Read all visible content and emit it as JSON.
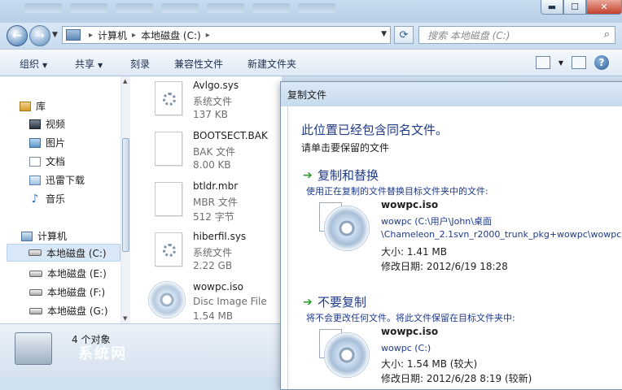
{
  "explorer": {
    "address_segments": [
      "计算机",
      "本地磁盘 (C:)"
    ],
    "search_placeholder": "搜索 本地磁盘 (C:)",
    "toolbar": {
      "organize": "组织",
      "share": "共享",
      "burn": "刻录",
      "compat_files": "兼容性文件",
      "new_folder": "新建文件夹"
    },
    "nav": {
      "library": "库",
      "videos": "视频",
      "pictures": "图片",
      "documents": "文档",
      "thunder": "迅雷下载",
      "music": "音乐",
      "computer": "计算机",
      "drive_c": "本地磁盘 (C:)",
      "drive_e": "本地磁盘 (E:)",
      "drive_f": "本地磁盘 (F:)",
      "drive_g": "本地磁盘 (G:)"
    },
    "files": [
      {
        "name": "Avlgo.sys",
        "type": "系统文件",
        "size": "137 KB",
        "icon": "gear-file-icon"
      },
      {
        "name": "BOOTSECT.BAK",
        "type": "BAK 文件",
        "size": "8.00 KB",
        "icon": "blank-file-icon"
      },
      {
        "name": "btldr.mbr",
        "type": "MBR 文件",
        "size": "512 字节",
        "icon": "blank-file-icon"
      },
      {
        "name": "hiberfil.sys",
        "type": "系统文件",
        "size": "2.22 GB",
        "icon": "gear-file-icon"
      },
      {
        "name": "wowpc.iso",
        "type": "Disc Image File",
        "size": "1.54 MB",
        "icon": "disc-icon"
      }
    ],
    "status_count": "4 个对象",
    "watermark": "系统网"
  },
  "dialog": {
    "title": "复制文件",
    "heading": "此位置已经包含同名文件。",
    "subheading": "请单击要保留的文件",
    "replace": {
      "title": "复制和替换",
      "desc": "使用正在复制的文件替换目标文件夹中的文件:",
      "file_name": "wowpc.iso",
      "path_line1": "wowpc (C:\\用户\\John\\桌面",
      "path_line2": "\\Chameleon_2.1svn_r2000_trunk_pkg+wowpc\\wowpc",
      "size": "大小: 1.41 MB",
      "date": "修改日期: 2012/6/19 18:28"
    },
    "skip": {
      "title": "不要复制",
      "desc": "将不会更改任何文件。将此文件保留在目标文件夹中:",
      "file_name": "wowpc.iso",
      "path": "wowpc (C:)",
      "size": "大小: 1.54 MB (较大)",
      "date": "修改日期: 2012/6/28 8:19 (较新)"
    }
  }
}
